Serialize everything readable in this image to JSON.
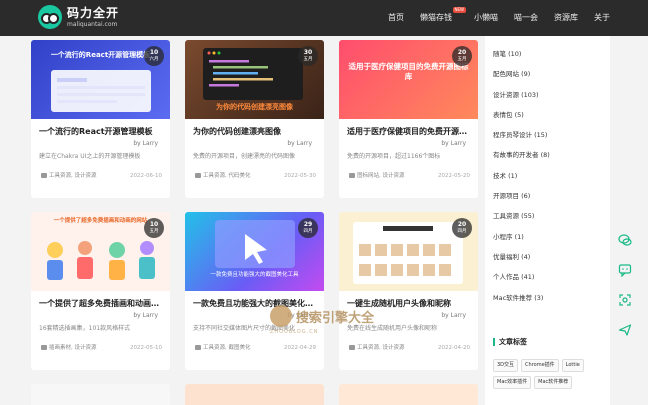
{
  "site": {
    "logo_title": "码力全开",
    "logo_sub": "maliquantai.com"
  },
  "nav": [
    {
      "label": "首页"
    },
    {
      "label": "懒猫存钱",
      "badge": "NEW"
    },
    {
      "label": "小懒喵"
    },
    {
      "label": "喵一会"
    },
    {
      "label": "资源库"
    },
    {
      "label": "关于"
    }
  ],
  "cards": [
    {
      "thumb_text": "一个流行的React开源管理模板",
      "day": "10",
      "month": "六月",
      "title": "一个流行的React开源管理模板",
      "author": "by Larry",
      "excerpt": "建立在Chakra UI之上的开源管理模板",
      "tags": "工具资源, 设计资源",
      "date": "2022-06-10",
      "bg": "#3b4fd6"
    },
    {
      "thumb_text": "为你的代码创建漂亮图像",
      "day": "30",
      "month": "五月",
      "title": "为你的代码创建漂亮图像",
      "author": "by Larry",
      "excerpt": "免费的开源项目，创建漂亮的代码图像",
      "tags": "工具资源, 代码美化",
      "date": "2022-05-30",
      "bg": "#5a3a2a"
    },
    {
      "thumb_text": "适用于医疗保健项目的免费开源图标库",
      "day": "20",
      "month": "五月",
      "title": "适用于医疗保健项目的免费开源图标库",
      "author": "by Larry",
      "excerpt": "免费的开源项目，超过1166个图标",
      "tags": "图标网站, 设计资源",
      "date": "2022-05-20",
      "bg": "#ff5a6e"
    },
    {
      "thumb_text": "一个提供了超多免费插画和动画的网站",
      "day": "10",
      "month": "五月",
      "title": "一个提供了超多免费插画和动画素材的网站",
      "author": "by Larry",
      "excerpt": "16套精选插画集，101款风格样式",
      "tags": "插画素材, 设计资源",
      "date": "2022-05-10",
      "bg": "#fde9e3"
    },
    {
      "thumb_text": "一款免费且功能强大的截图美化工具",
      "day": "29",
      "month": "四月",
      "title": "一款免费且功能强大的截图美化工具",
      "author": "by Larry",
      "excerpt": "支持不同社交媒体图片尺寸的截图美化",
      "tags": "工具资源, 截图美化",
      "date": "2022-04-29",
      "bg": "#5b6cf2"
    },
    {
      "thumb_text": "一键生成随机用户头像和昵称",
      "day": "20",
      "month": "四月",
      "title": "一键生成随机用户头像和昵称",
      "author": "by Larry",
      "excerpt": "免费在线生成随机用户头像和昵称",
      "tags": "工具资源, 设计资源",
      "date": "2022-04-20",
      "bg": "#fbf3d8"
    }
  ],
  "sidebar": {
    "categories": [
      {
        "label": "随笔 (10)"
      },
      {
        "label": "配色网站 (9)"
      },
      {
        "label": "设计资源 (103)"
      },
      {
        "label": "表情包 (5)"
      },
      {
        "label": "程序员琴设计 (15)"
      },
      {
        "label": "有故事的开发者 (8)"
      },
      {
        "label": "技术 (1)"
      },
      {
        "label": "开源项目 (6)"
      },
      {
        "label": "工具资源 (55)"
      },
      {
        "label": "小程序 (1)"
      },
      {
        "label": "优量福利 (4)"
      },
      {
        "label": "个人作品 (41)"
      },
      {
        "label": "Mac软件推荐 (3)"
      }
    ],
    "tags_title": "文章标签",
    "tags": [
      {
        "label": "3D交互"
      },
      {
        "label": "Chrome插件"
      },
      {
        "label": "Lottie"
      },
      {
        "label": "Mac效率插件"
      },
      {
        "label": "Mac软件推荐"
      }
    ]
  },
  "watermark": {
    "text": "搜索引擎大全",
    "sub": "ZHOUBLOG.CN"
  }
}
